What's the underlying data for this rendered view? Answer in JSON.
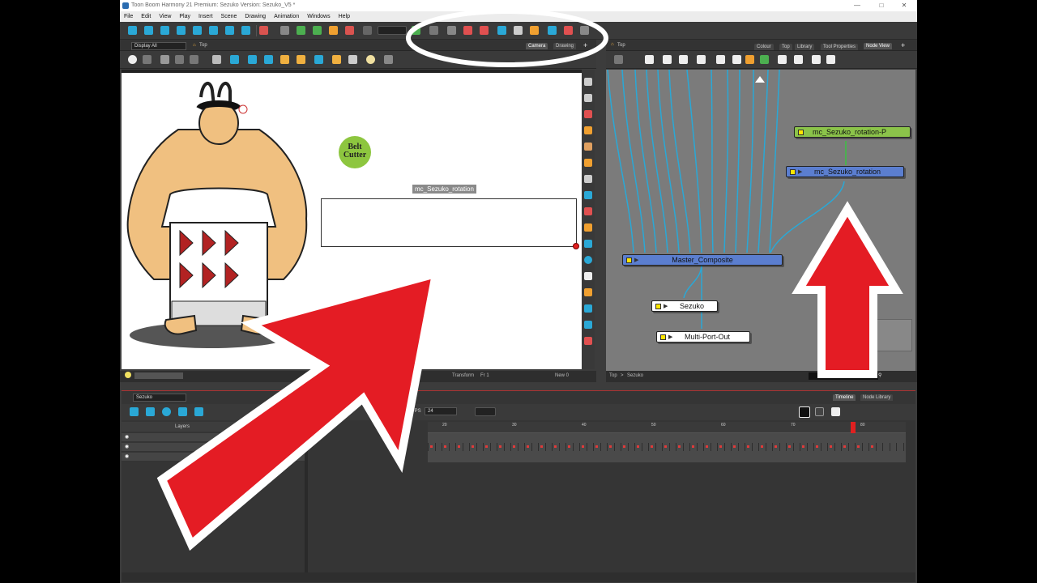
{
  "window": {
    "title": "Toon Boom Harmony 21 Premium: Sezuko Version: Sezuko_V5 *",
    "minimize": "—",
    "maximize": "□",
    "close": "✕"
  },
  "menu": [
    "File",
    "Edit",
    "View",
    "Play",
    "Insert",
    "Scene",
    "Drawing",
    "Animation",
    "Windows",
    "Help"
  ],
  "camera_panel": {
    "display_dropdown": "Display All",
    "breadcrumb": "Top",
    "tabs": [
      "Camera",
      "Drawing"
    ],
    "active_tab": "Camera",
    "status_mode": "Transform",
    "status_frame": "Fr 1",
    "status_view": "New 0"
  },
  "canvas": {
    "badge_line1": "Belt",
    "badge_line2": "Cutter",
    "peg_label": "mc_Sezuko_rotation"
  },
  "node_panel": {
    "breadcrumb": "Top",
    "tabs": [
      "Colour",
      "Top",
      "Library",
      "Tool Properties",
      "Node View"
    ],
    "active_tab": "Node View",
    "nodes": {
      "peg_parent": "mc_Sezuko_rotation-P",
      "peg": "mc_Sezuko_rotation",
      "composite": "Master_Composite",
      "group": "Sezuko",
      "output": "Multi-Port-Out"
    },
    "footer_path_root": "Top",
    "footer_path_sep": ">",
    "footer_path_child": "Sezuko"
  },
  "timeline": {
    "scene_dropdown": "Sezuko",
    "tabs": [
      "Timeline",
      "Node Library"
    ],
    "active_tab": "Timeline",
    "fps_label": "FPS",
    "fps_value": "24",
    "layers_header": "Layers",
    "ruler_ticks": [
      "20",
      "30",
      "40",
      "50",
      "60",
      "70",
      "80"
    ],
    "current_frame": 80
  },
  "colors": {
    "arrow_red": "#e41c24",
    "node_green": "#8bc34a",
    "node_blue": "#5b7ecf",
    "connection_blue": "#2aa8d6",
    "badge_green": "#8dc63f"
  }
}
